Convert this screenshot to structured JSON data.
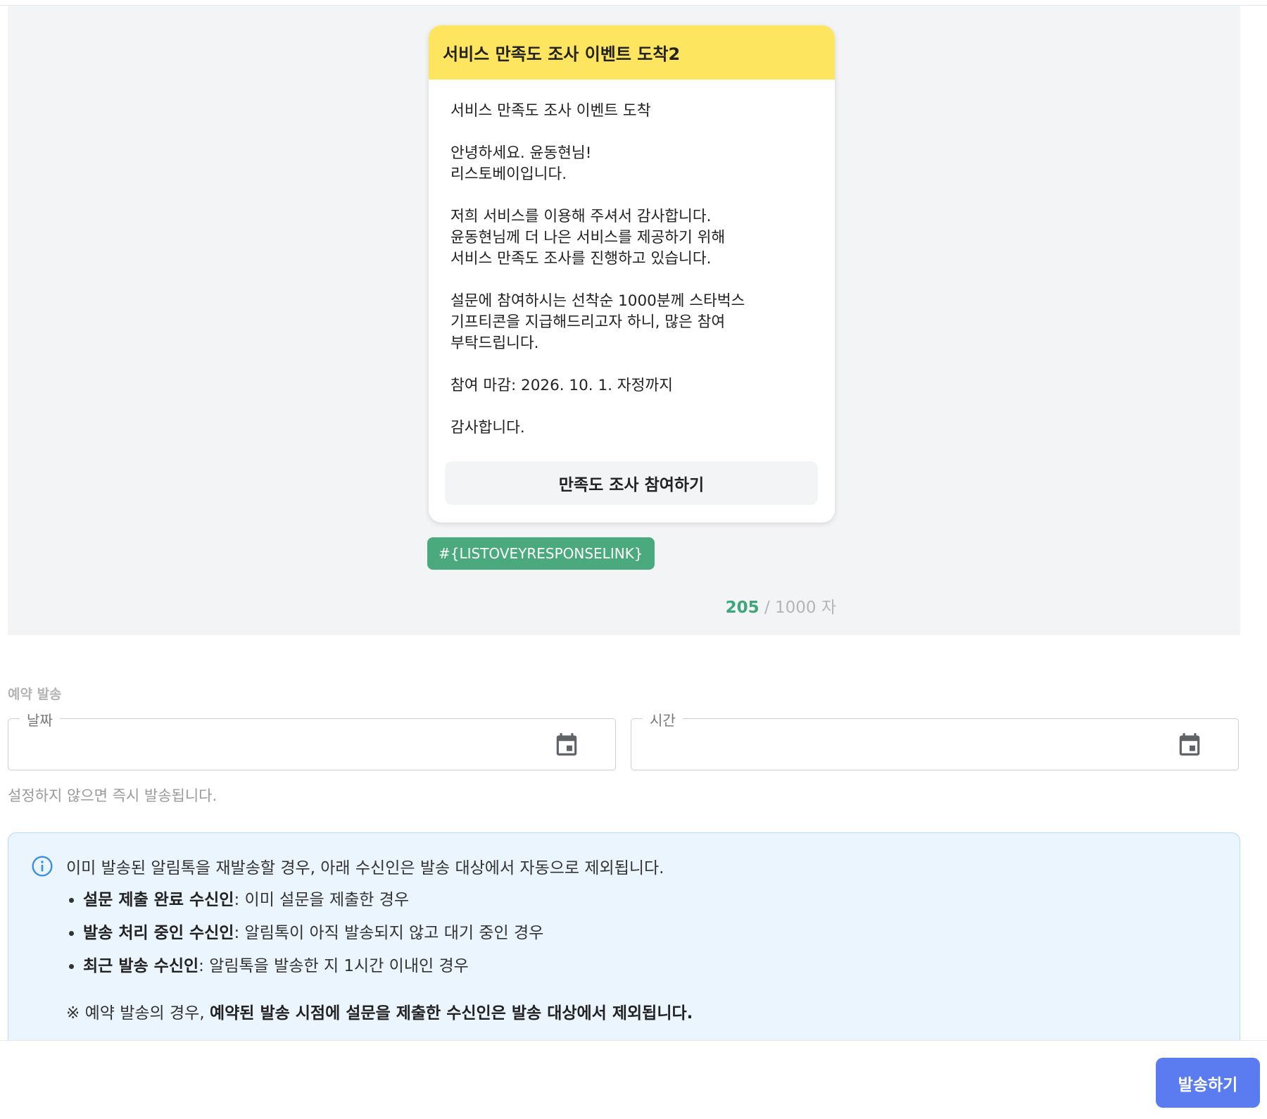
{
  "message_preview": {
    "title": "서비스 만족도 조사 이벤트 도착2",
    "body": "서비스 만족도 조사 이벤트 도착\n\n안녕하세요. 윤동현님!\n리스토베이입니다.\n\n저희 서비스를 이용해 주셔서 감사합니다.\n윤동현님께 더 나은 서비스를 제공하기 위해\n서비스 만족도 조사를 진행하고 있습니다.\n\n설문에 참여하시는 선착순 1000분께 스타벅스\n기프티콘을 지급해드리고자 하니, 많은 참여\n부탁드립니다.\n\n참여 마감: 2026. 10. 1. 자정까지\n\n감사합니다.",
    "button_label": "만족도 조사 참여하기",
    "link_variable": "#{LISTOVEYRESPONSELINK}",
    "char_count_used": "205",
    "char_count_total": " / 1000 자"
  },
  "schedule": {
    "section_label": "예약 발송",
    "date_label": "날짜",
    "date_value": "",
    "time_label": "시간",
    "time_value": "",
    "helper_text": "설정하지 않으면 즉시 발송됩니다.",
    "icon": "calendar-icon"
  },
  "notice": {
    "main_text": "이미 발송된 알림톡을 재발송할 경우, 아래 수신인은 발송 대상에서 자동으로 제외됩니다.",
    "items": [
      {
        "bold": "설문 제출 완료 수신인",
        "text": ": 이미 설문을 제출한 경우"
      },
      {
        "bold": "발송 처리 중인 수신인",
        "text": ": 알림톡이 아직 발송되지 않고 대기 중인 경우"
      },
      {
        "bold": "최근 발송 수신인",
        "text": ": 알림톡을 발송한 지 1시간 이내인 경우"
      }
    ],
    "note_prefix": "※ 예약 발송의 경우, ",
    "note_bold": "예약된 발송 시점에 설문을 제출한 수신인은 발송 대상에서 제외됩니다.",
    "icon": "info-icon"
  },
  "footer": {
    "send_label": "발송하기"
  },
  "colors": {
    "header_yellow": "#fde560",
    "link_green": "#4aa97d",
    "count_green": "#3ca77a",
    "send_blue": "#5a7cf0",
    "info_bg": "#ebf5fe",
    "info_icon": "#3b8fe0"
  }
}
